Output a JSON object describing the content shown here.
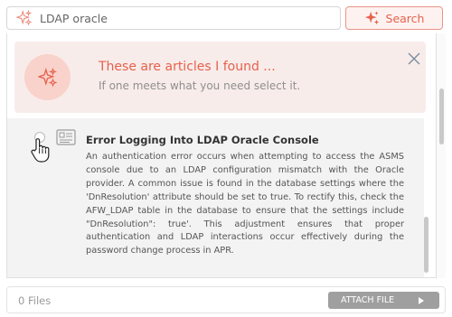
{
  "search": {
    "value": "LDAP oracle",
    "button_label": "Search"
  },
  "banner": {
    "title": "These are articles I found ...",
    "subtitle": "If one meets what you need select it."
  },
  "article": {
    "title": "Error Logging Into LDAP Oracle Console",
    "body": "An authentication error occurs when attempting to access the ASMS console due to an LDAP configuration mismatch with the Oracle provider. A common issue is found in the database settings where the 'DnResolution' attribute should be set to true. To rectify this, check the AFW_LDAP table in the database to ensure that the settings include \"DnResolution\": true'. This adjustment ensures that proper authentication and LDAP interactions occur effectively during the password change process in APR."
  },
  "footer": {
    "files_label": "0 Files",
    "attach_label": "ATTACH FILE"
  },
  "colors": {
    "accent": "#e6614c",
    "banner_bg": "#f8ecea",
    "article_bg": "#f3f3f3",
    "attach_bg": "#9f9f9f"
  },
  "icons": [
    "sparkle-icon",
    "close-icon",
    "document-icon",
    "hand-cursor-icon",
    "play-icon"
  ]
}
